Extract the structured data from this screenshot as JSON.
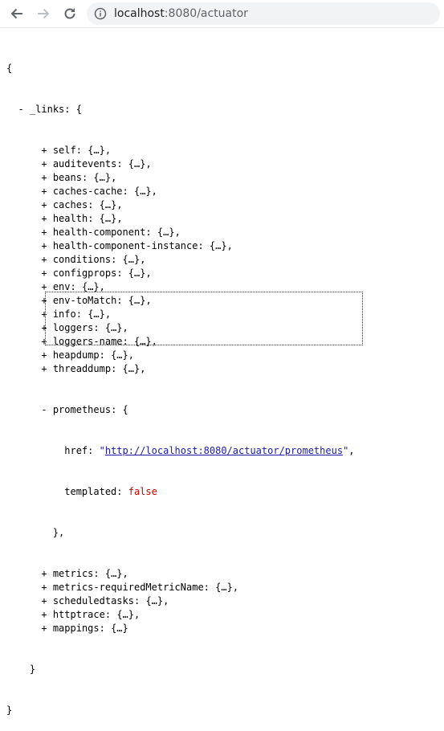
{
  "browser": {
    "back_icon": "arrow-left-icon",
    "forward_icon": "arrow-right-icon",
    "reload_icon": "reload-icon",
    "info_icon": "info-icon",
    "url_host": "localhost",
    "url_rest": ":8080/actuator"
  },
  "json": {
    "root_open": "{",
    "root_close": "}",
    "links_toggle": "-",
    "links_key": "_links",
    "links_open": "{",
    "links_close": "}",
    "collapsed": "{…}",
    "collapsed_last": "{…}",
    "entries_before": [
      "self",
      "auditevents",
      "beans",
      "caches-cache",
      "caches",
      "health",
      "health-component",
      "health-component-instance",
      "conditions",
      "configprops",
      "env",
      "env-toMatch",
      "info",
      "loggers",
      "loggers-name",
      "heapdump",
      "threaddump"
    ],
    "expanded": {
      "toggle": "-",
      "key": "prometheus",
      "href_key": "href",
      "href_value": "http://localhost:8080/actuator/prometheus",
      "templated_key": "templated",
      "templated_value": "false",
      "close": "},"
    },
    "entries_after": [
      "metrics",
      "metrics-requiredMetricName",
      "scheduledtasks",
      "httptrace",
      "mappings"
    ],
    "expand_marker": "+"
  },
  "colors": {
    "string": "#1a1aa6",
    "boolean": "#c80000",
    "address_bar": "#f1f3f4"
  }
}
